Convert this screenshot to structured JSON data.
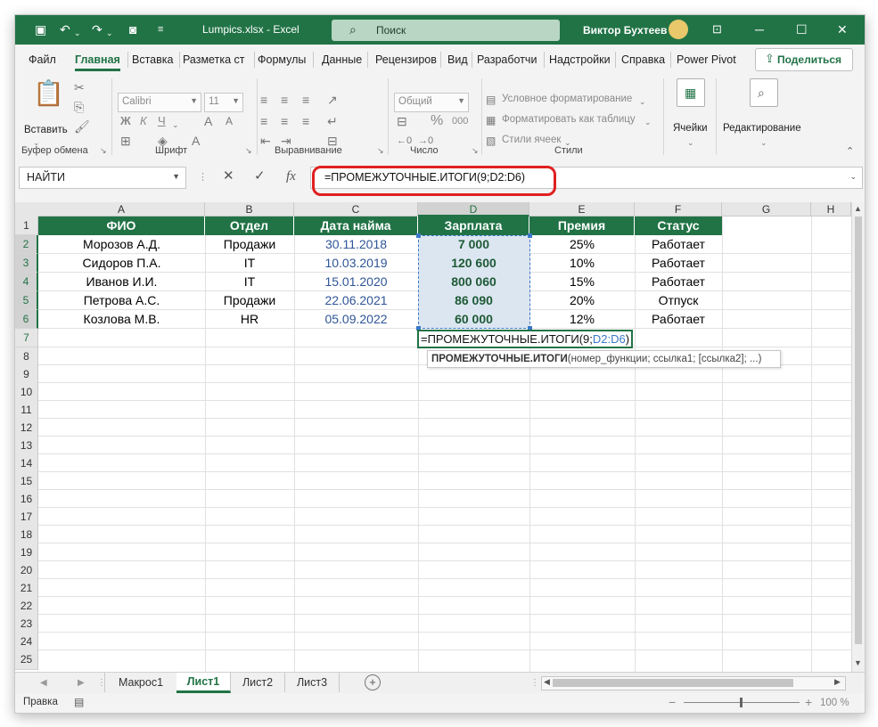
{
  "app": {
    "title": "Lumpics.xlsx  -  Excel",
    "search_placeholder": "Поиск",
    "user": "Виктор Бухтеев"
  },
  "ribbon_tabs": [
    "Файл",
    "Главная",
    "Вставка",
    "Разметка ст",
    "Формулы",
    "Данные",
    "Рецензиров",
    "Вид",
    "Разработчи",
    "Надстройки",
    "Справка",
    "Power Pivot"
  ],
  "active_tab": "Главная",
  "share_label": "Поделиться",
  "ribbon": {
    "paste_label": "Вставить",
    "font_name": "Calibri",
    "font_size": "11",
    "bold": "Ж",
    "italic": "К",
    "underline": "Ч",
    "number_format": "Общий",
    "percent": "%",
    "thousands": "000",
    "cond_format": "Условное форматирование",
    "format_table": "Форматировать как таблицу",
    "cell_styles": "Стили ячеек",
    "cells_label": "Ячейки",
    "editing_label": "Редактирование",
    "groups": {
      "clipboard": "Буфер обмена",
      "font": "Шрифт",
      "alignment": "Выравнивание",
      "number": "Число",
      "styles": "Стили"
    }
  },
  "formula_bar": {
    "name_box": "НАЙТИ",
    "cancel": "✕",
    "enter": "✓",
    "fx": "fx",
    "formula": "=ПРОМЕЖУТОЧНЫЕ.ИТОГИ(9;D2:D6)"
  },
  "grid": {
    "columns": [
      "A",
      "B",
      "C",
      "D",
      "E",
      "F",
      "G",
      "H"
    ],
    "rows": [
      "1",
      "2",
      "3",
      "4",
      "5",
      "6",
      "7",
      "8",
      "9",
      "10",
      "11",
      "12",
      "13",
      "14",
      "15",
      "16",
      "17",
      "18",
      "19",
      "20",
      "21",
      "22",
      "23",
      "24",
      "25"
    ],
    "headers": [
      "ФИО",
      "Отдел",
      "Дата найма",
      "Зарплата",
      "Премия",
      "Статус"
    ],
    "data": [
      [
        "Морозов А.Д.",
        "Продажи",
        "30.11.2018",
        "7 000",
        "25%",
        "Работает"
      ],
      [
        "Сидоров П.А.",
        "IT",
        "10.03.2019",
        "120 600",
        "10%",
        "Работает"
      ],
      [
        "Иванов И.И.",
        "IT",
        "15.01.2020",
        "800 060",
        "15%",
        "Работает"
      ],
      [
        "Петрова А.С.",
        "Продажи",
        "22.06.2021",
        "86 090",
        "20%",
        "Отпуск"
      ],
      [
        "Козлова М.В.",
        "HR",
        "05.09.2022",
        "60 000",
        "12%",
        "Работает"
      ]
    ],
    "edit_cell": {
      "prefix": "=ПРОМЕЖУТОЧНЫЕ.ИТОГИ(9;",
      "ref": "D2:D6",
      "suffix": ")"
    },
    "tooltip": {
      "fn": "ПРОМЕЖУТОЧНЫЕ.ИТОГИ",
      "args": "(номер_функции; ссылка1; [ссылка2]; ...)"
    }
  },
  "sheets": [
    "Макрос1",
    "Лист1",
    "Лист2",
    "Лист3"
  ],
  "active_sheet": "Лист1",
  "status": {
    "mode": "Правка",
    "zoom": "100 %"
  },
  "colors": {
    "accent": "#217346",
    "header_fill": "#217346",
    "salary_fill": "#dce6f1",
    "date_text": "#2f5597",
    "ref_text": "#3a78c8",
    "highlight": "#e02020"
  }
}
